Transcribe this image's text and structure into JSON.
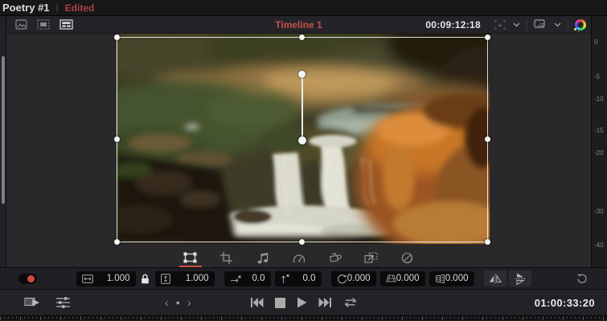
{
  "title_bar": {
    "project": "Poetry #1",
    "separator": "|",
    "status": "Edited"
  },
  "viewer": {
    "timeline_label": "Timeline 1",
    "timecode": "00:09:12:18",
    "left_icons": [
      "image-thumbnail-icon",
      "film-frame-icon",
      "timeline-strip-icon"
    ],
    "right_icons": [
      "resize-preview-icon",
      "monitor-grid-icon",
      "color-wheel-icon"
    ],
    "active_source": "timeline"
  },
  "tool_dock": {
    "tools": [
      "transform",
      "crop",
      "audio",
      "retime",
      "camera-3d",
      "dynamic-zoom",
      "blend"
    ],
    "active_tool": "transform"
  },
  "transform_toolbar": {
    "enabled": true,
    "fields": [
      {
        "name": "zoom-x",
        "value": "1.000"
      },
      {
        "name": "zoom-y",
        "value": "1.000"
      },
      {
        "name": "position-x",
        "value": "0.0"
      },
      {
        "name": "position-y",
        "value": "0.0"
      },
      {
        "name": "rotation-angle",
        "value": "0.000"
      },
      {
        "name": "pitch",
        "value": "0.000"
      },
      {
        "name": "yaw",
        "value": "0.000"
      }
    ],
    "flip_buttons": [
      "flip-horizontal",
      "flip-vertical"
    ],
    "reset": "reset-transform"
  },
  "transport": {
    "left_icons": [
      "clip-play-icon",
      "mixer-sliders-icon"
    ],
    "jog": {
      "left": "‹",
      "dot": "●",
      "right": "›"
    },
    "buttons": [
      "go-to-start",
      "stop",
      "play",
      "go-to-end",
      "loop"
    ],
    "timecode": "01:00:33:20"
  },
  "audio_meter": {
    "labels": [
      "0",
      "-5",
      "-10",
      "-15",
      "-20",
      "-30",
      "-40"
    ]
  },
  "colors": {
    "accent_red": "#cf4f46",
    "edited_red": "#a8423d",
    "toggle_red": "#d6493f"
  }
}
